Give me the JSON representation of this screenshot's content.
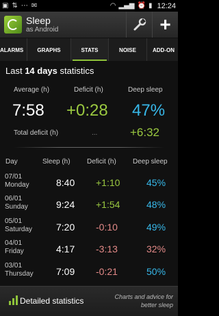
{
  "status_bar": {
    "time": "12:24",
    "left_icons": [
      "app-notification-icon",
      "data-sync-icon",
      "nfc-icon",
      "gmail-icon"
    ],
    "right_icons": [
      "wifi-icon",
      "signal-icon",
      "alarm-icon",
      "battery-icon"
    ]
  },
  "action_bar": {
    "title": "Sleep",
    "subtitle": "as Android",
    "actions": [
      "wrench-icon",
      "plus-icon"
    ],
    "plus_label": "+"
  },
  "tabs": [
    {
      "label": "ALARMS",
      "active": false
    },
    {
      "label": "GRAPHS",
      "active": false
    },
    {
      "label": "STATS",
      "active": true
    },
    {
      "label": "NOISE",
      "active": false
    },
    {
      "label": "ADD-ON",
      "active": false
    }
  ],
  "stats": {
    "heading_prefix": "Last ",
    "heading_bold": "14 days",
    "heading_suffix": " statistics",
    "summary": {
      "average_label": "Average (h)",
      "deficit_label": "Deficit (h)",
      "deep_label": "Deep sleep",
      "average_value": "7:58",
      "deficit_value": "+0:28",
      "deep_value": "47%"
    },
    "total_deficit_label": "Total deficit (h)",
    "total_deficit_dots": "...",
    "total_deficit_value": "+6:32",
    "columns": [
      "Day",
      "Sleep (h)",
      "Deficit (h)",
      "Deep sleep"
    ],
    "rows": [
      {
        "date": "07/01",
        "weekday": "Monday",
        "sleep": "8:40",
        "deficit": "+1:10",
        "deep": "45%",
        "deficit_color": "#9ac840"
      },
      {
        "date": "06/01",
        "weekday": "Sunday",
        "sleep": "9:24",
        "deficit": "+1:54",
        "deep": "48%",
        "deficit_color": "#9ac840"
      },
      {
        "date": "05/01",
        "weekday": "Saturday",
        "sleep": "7:20",
        "deficit": "-0:10",
        "deep": "49%",
        "deficit_color": "#e38a88"
      },
      {
        "date": "04/01",
        "weekday": "Friday",
        "sleep": "4:17",
        "deficit": "-3:13",
        "deep": "32%",
        "deficit_color": "#e38a88"
      },
      {
        "date": "03/01",
        "weekday": "Thursday",
        "sleep": "7:09",
        "deficit": "-0:21",
        "deep": "50%",
        "deficit_color": "#e38a88"
      }
    ]
  },
  "bottom_bar": {
    "detail_label": "Detailed statistics",
    "promo_text": "Charts and advice for better sleep"
  },
  "colors": {
    "accent_green": "#8fc33a",
    "positive": "#9ac840",
    "negative": "#e38a88",
    "deep_sleep": "#37b7e8"
  }
}
